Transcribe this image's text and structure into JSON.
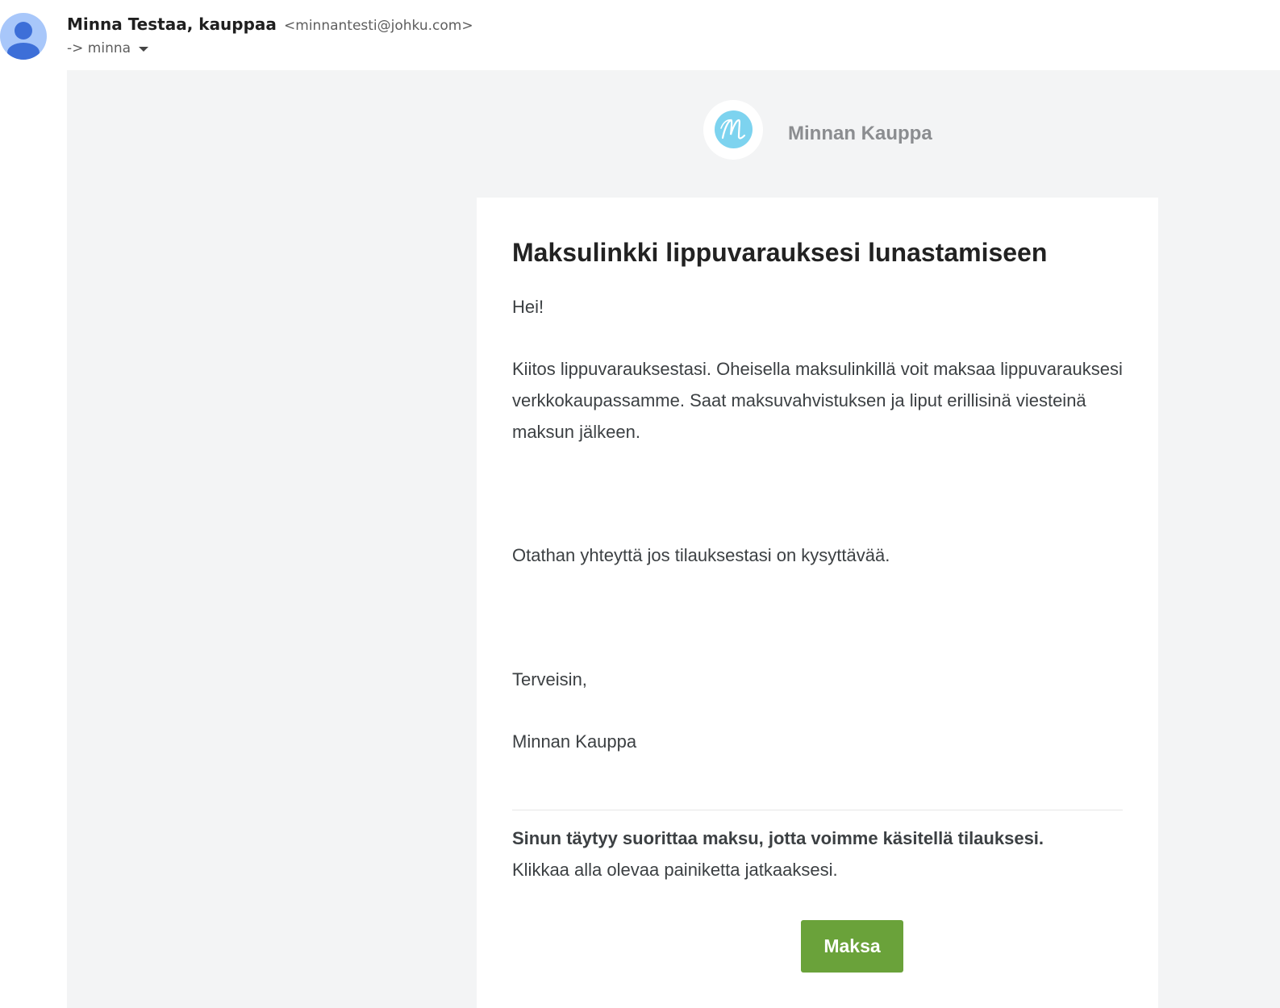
{
  "header": {
    "sender_name": "Minna Testaa, kauppaa",
    "sender_email": "<minnantesti@johku.com>",
    "recipient": "-> minna",
    "avatar_icon": "person-icon",
    "dropdown_icon": "caret-down-icon"
  },
  "email": {
    "brand_logo_letter": "M",
    "brand_name": "Minnan Kauppa",
    "title": "Maksulinkki lippuvarauksesi lunastamiseen",
    "greeting": "Hei!",
    "body": "Kiitos lippuvarauksestasi. Oheisella maksulinkillä voit maksaa lippuvarauksesi verkkokaupassamme. Saat maksuvahvistuksen ja liput erillisinä viesteinä maksun jälkeen.",
    "contact": "Otathan yhteyttä jos tilauksestasi on kysyttävää.",
    "regards": "Terveisin,",
    "signature": "Minnan Kauppa",
    "notice_bold": "Sinun täytyy suorittaa maksu, jotta voimme käsitellä tilauksesi.",
    "notice_text": "Klikkaa alla olevaa painiketta jatkaaksesi.",
    "pay_button": "Maksa"
  },
  "colors": {
    "avatar_bg": "#a8c7fa",
    "avatar_fg": "#3d6fd8",
    "mail_bg": "#f3f4f5",
    "brand_circle": "#7dd3ef",
    "pay_button": "#6aa23a"
  }
}
